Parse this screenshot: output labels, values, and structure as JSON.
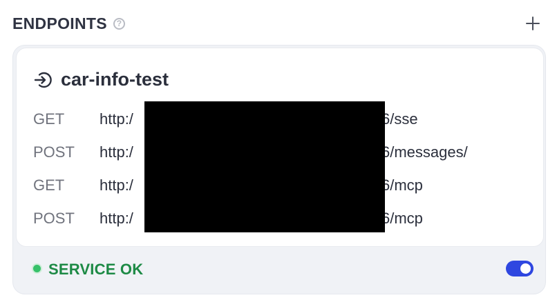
{
  "header": {
    "title": "ENDPOINTS",
    "help_icon": "question-circle-icon",
    "add_icon": "plus-icon"
  },
  "endpoint": {
    "name": "car-info-test",
    "icon": "arrow-into-circle-icon",
    "routes": [
      {
        "method": "GET",
        "url_prefix": "http:/",
        "url_suffix": "6/sse"
      },
      {
        "method": "POST",
        "url_prefix": "http:/",
        "url_suffix": "6/messages/"
      },
      {
        "method": "GET",
        "url_prefix": "http:/",
        "url_suffix": "6/mcp"
      },
      {
        "method": "POST",
        "url_prefix": "http:/",
        "url_suffix": "6/mcp"
      }
    ]
  },
  "status": {
    "text": "SERVICE OK",
    "color": "#1d8a45",
    "dot_color": "#37c16a",
    "enabled": true
  },
  "colors": {
    "accent": "#2f47e0",
    "card_bg": "#f0f2f6"
  }
}
